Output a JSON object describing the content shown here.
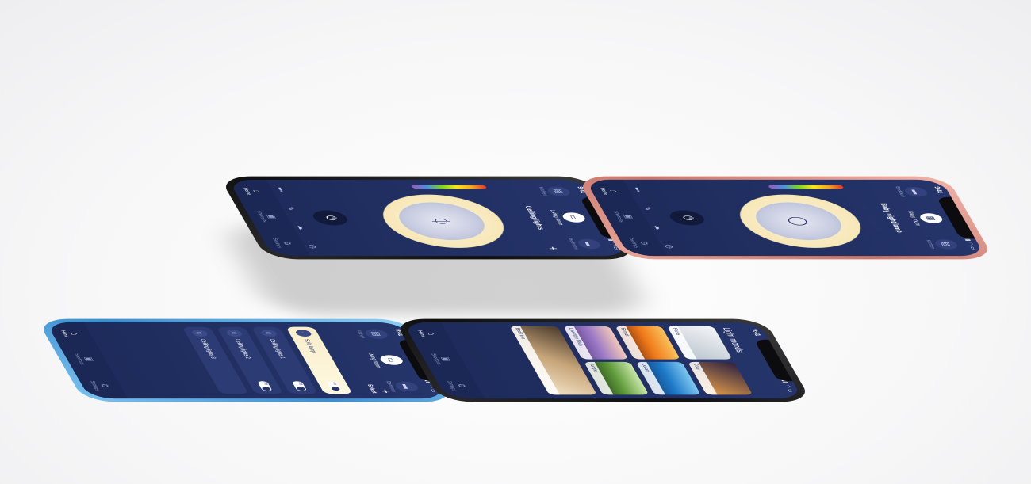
{
  "status": {
    "time": "9:41"
  },
  "phone_ceiling": {
    "rooms": [
      {
        "label": "Kitchen",
        "icon": "kitchen-icon"
      },
      {
        "label": "Living room",
        "icon": "living-room-icon"
      },
      {
        "label": "Bedroom",
        "icon": "bedroom-icon"
      }
    ],
    "device_title": "Ceiling lights",
    "tabs": [
      {
        "label": "Home"
      },
      {
        "label": "Shortcuts"
      },
      {
        "label": "Settings"
      }
    ]
  },
  "phone_baby": {
    "rooms": [
      {
        "label": "Bedroom",
        "icon": "bedroom-icon"
      },
      {
        "label": "Baby room",
        "icon": "baby-room-icon"
      },
      {
        "label": "Kitchen",
        "icon": "kitchen-icon"
      }
    ],
    "device_title": "Baby night lamp",
    "timer": "00:14:59 s",
    "tabs": [
      {
        "label": "Home"
      },
      {
        "label": "Shortcuts"
      },
      {
        "label": "Settings"
      }
    ]
  },
  "phone_list": {
    "rooms": [
      {
        "label": "Kitchen",
        "icon": "kitchen-icon"
      },
      {
        "label": "Living room",
        "icon": "living-room-icon"
      },
      {
        "label": "Bedroom",
        "icon": "bedroom-icon"
      }
    ],
    "select_label": "Select",
    "toggle_on": "on",
    "toggle_off": "off",
    "devices": [
      {
        "name": "Sofa lamp"
      },
      {
        "name": "Ceiling lights 1"
      },
      {
        "name": "Ceiling lights 2"
      },
      {
        "name": "Ceiling lights 3"
      }
    ],
    "tabs": [
      {
        "label": "Home"
      },
      {
        "label": "Shortcuts"
      },
      {
        "label": "Settings"
      }
    ]
  },
  "phone_moods": {
    "title": "Light moods",
    "moods": [
      {
        "label": "Focus",
        "color": "#dfe4ea"
      },
      {
        "label": "Cozy",
        "color": "#e8a04a"
      },
      {
        "label": "Sunset",
        "color": "#f07a1a"
      },
      {
        "label": "Ocean",
        "color": "#1f7ac8"
      },
      {
        "label": "Lavender fields",
        "color": "#9b78c6"
      },
      {
        "label": "Jungle",
        "color": "#5f9a3a"
      },
      {
        "label": "Bed Time",
        "color": "#c7a57a"
      }
    ],
    "tabs": [
      {
        "label": "Home"
      },
      {
        "label": "Shortcuts"
      },
      {
        "label": "Settings"
      }
    ]
  }
}
